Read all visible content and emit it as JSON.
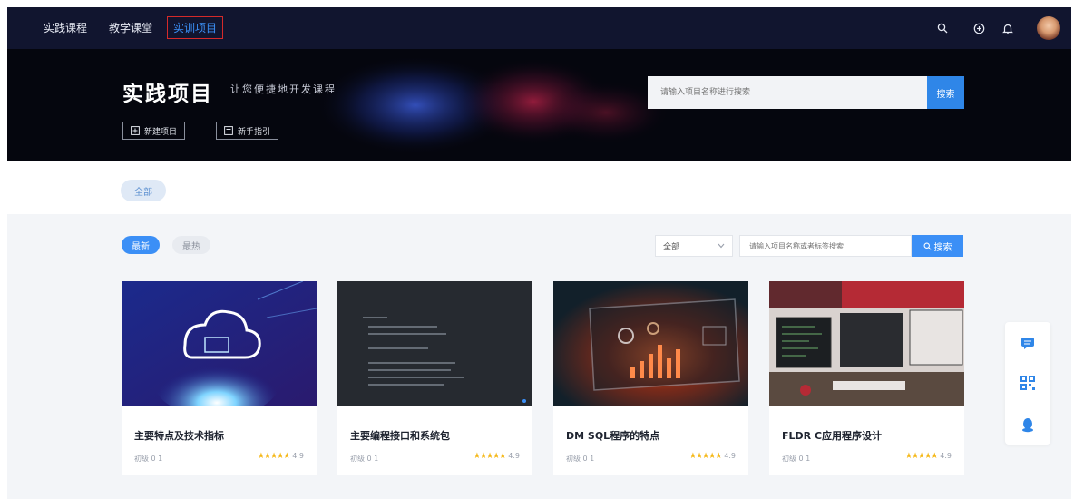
{
  "nav": {
    "links": [
      "实践课程",
      "教学课堂",
      "实训项目"
    ],
    "active_index": 2,
    "icons": [
      "search-icon",
      "plus-circle-icon",
      "bell-icon"
    ]
  },
  "banner": {
    "title": "实践项目",
    "subtitle": "让您便捷地开发课程",
    "buttons": [
      {
        "label": "新建项目",
        "icon": "plus-square-icon"
      },
      {
        "label": "新手指引",
        "icon": "list-icon"
      }
    ],
    "search": {
      "placeholder": "请输入项目名称进行搜索",
      "button": "搜索"
    }
  },
  "category": {
    "label": "全部"
  },
  "tabs": [
    "最新",
    "最热"
  ],
  "filter": {
    "select_value": "全部",
    "input_placeholder": "请输入项目名称或者标签搜索",
    "button": "搜索"
  },
  "cards": [
    {
      "title": "主要特点及技术指标",
      "meta": "初级 0 1",
      "score": "4.9"
    },
    {
      "title": "主要编程接口和系统包",
      "meta": "初级 0 1",
      "score": "4.9"
    },
    {
      "title": "DM SQL程序的特点",
      "meta": "初级 0 1",
      "score": "4.9"
    },
    {
      "title": "FLDR C应用程序设计",
      "meta": "初级 0 1",
      "score": "4.9"
    }
  ],
  "stars_text": "★★★★★",
  "side_icons": [
    "chat-icon",
    "qrcode-icon",
    "qq-icon"
  ],
  "colors": {
    "nav_bg": "#11152f",
    "accent": "#3b8ff6",
    "star": "#f5b818",
    "highlight_border": "#d42a2a"
  }
}
